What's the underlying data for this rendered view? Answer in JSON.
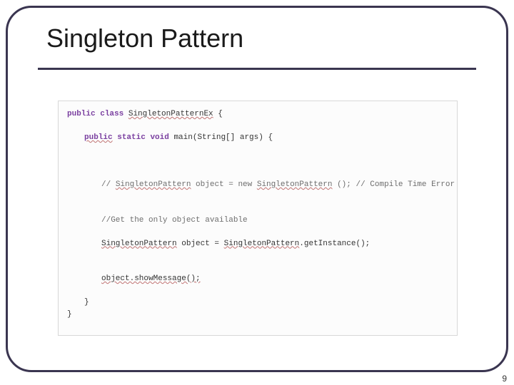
{
  "slide": {
    "title": "Singleton Pattern",
    "page_number": "9"
  },
  "code": {
    "l1_kw1": "public",
    "l1_kw2": "class",
    "l1_cls": "SingletonPatternEx",
    "l1_tail": " {",
    "l2_lead": "public",
    "l2_kw2": "static",
    "l2_kw3": "void",
    "l2_tail": " main(String[] args) {",
    "l3_c1": "// ",
    "l3_u1": "SingletonPattern",
    "l3_c2": " object = new ",
    "l3_u2": "SingletonPattern",
    "l3_c3": " (); // Compile Time Error",
    "l4": "//Get the only object available",
    "l5_u1": "SingletonPattern",
    "l5_mid": " object = ",
    "l5_u2": "SingletonPattern",
    "l5_tail": ".getInstance();",
    "l6": "object.showMessage();",
    "l7": "}",
    "l8": "}"
  }
}
